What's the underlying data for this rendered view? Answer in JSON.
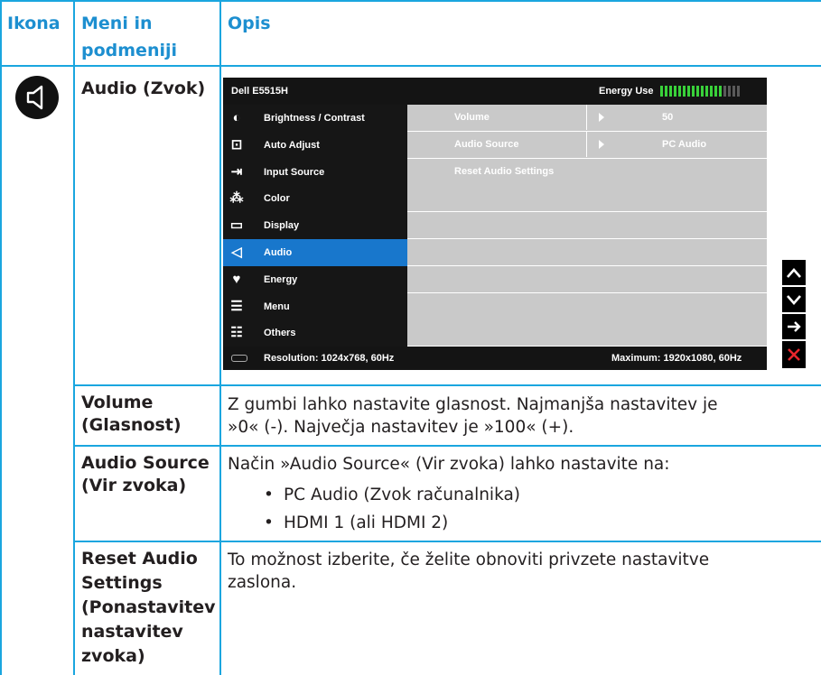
{
  "header": {
    "col_icon": "Ikona",
    "col_menu_line1": "Meni in",
    "col_menu_line2": "podmeniji",
    "col_desc": "Opis"
  },
  "rows": {
    "audio": {
      "menu": "Audio (Zvok)",
      "icon": "speaker-icon"
    },
    "volume": {
      "menu_line1": "Volume",
      "menu_line2": "(Glasnost)",
      "desc_line1": "Z gumbi lahko nastavite glasnost. Najmanjša nastavitev je",
      "desc_line2": "»0« (-). Največja nastavitev je »100« (+)."
    },
    "audio_source": {
      "menu_line1": "Audio Source",
      "menu_line2": "(Vir zvoka)",
      "desc": "Način »Audio Source« (Vir zvoka) lahko nastavite na:",
      "bullets": [
        "PC Audio (Zvok računalnika)",
        "HDMI 1 (ali HDMI 2)"
      ]
    },
    "reset": {
      "menu_lines": [
        "Reset Audio",
        "Settings",
        "(Ponastavitev",
        "nastavitev",
        "zvoka)"
      ],
      "desc_line1": "To možnost izberite, če želite obnoviti privzete nastavitve",
      "desc_line2": "zaslona."
    }
  },
  "osd": {
    "model": "Dell E5515H",
    "energy_label": "Energy Use",
    "energy_bars_lit": 14,
    "energy_bars_total": 18,
    "menu_items": [
      {
        "label": "Brightness / Contrast",
        "icon": "brightness-icon"
      },
      {
        "label": "Auto Adjust",
        "icon": "auto-adjust-icon"
      },
      {
        "label": "Input Source",
        "icon": "input-source-icon"
      },
      {
        "label": "Color",
        "icon": "color-icon"
      },
      {
        "label": "Display",
        "icon": "display-icon"
      },
      {
        "label": "Audio",
        "icon": "audio-icon"
      },
      {
        "label": "Energy",
        "icon": "energy-icon"
      },
      {
        "label": "Menu",
        "icon": "menu-icon"
      },
      {
        "label": "Others",
        "icon": "others-icon"
      }
    ],
    "selected_item": "Audio",
    "submenu": [
      {
        "key": "Volume",
        "value": "50"
      },
      {
        "key": "Audio Source",
        "value": "PC Audio"
      },
      {
        "key": "Reset Audio Settings",
        "value": ""
      }
    ],
    "resolution": "Resolution: 1024x768, 60Hz",
    "maximum": "Maximum: 1920x1080, 60Hz"
  },
  "nav_buttons": [
    "up-icon",
    "down-icon",
    "right-arrow-icon",
    "close-icon"
  ],
  "colors": {
    "accent": "#1aa6df",
    "header_text": "#1d8fd0",
    "osd_selected": "#1877cc",
    "osd_submenu": "#c9c9c9",
    "close_red": "#e8262c",
    "energy_green": "#39d13a"
  }
}
